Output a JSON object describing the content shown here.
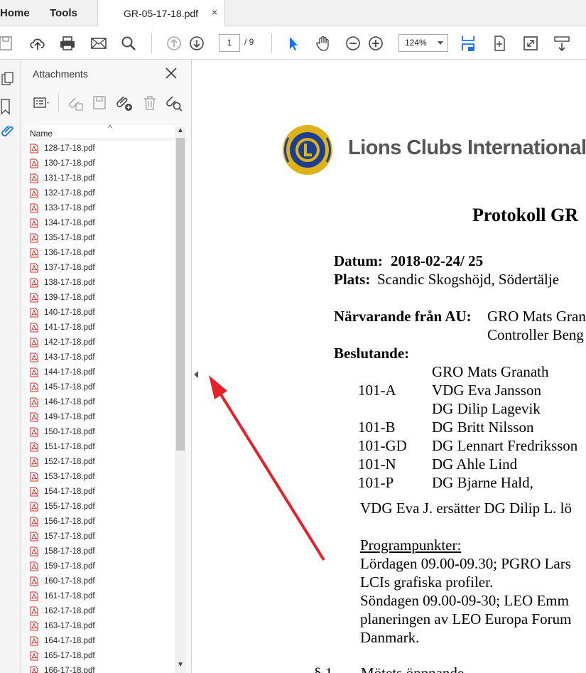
{
  "tabs": {
    "home": "Home",
    "tools": "Tools",
    "doc_tab": "GR-05-17-18.pdf",
    "close": "×"
  },
  "toolbar": {
    "page_current": "1",
    "page_total": "/ 9",
    "zoom": "124%"
  },
  "panel": {
    "title": "Attachments",
    "close": "✕",
    "column_name": "Name",
    "sort_icon": "^",
    "files": [
      "128-17-18.pdf",
      "130-17-18.pdf",
      "131-17-18.pdf",
      "132-17-18.pdf",
      "133-17-18.pdf",
      "134-17-18.pdf",
      "135-17-18.pdf",
      "136-17-18.pdf",
      "137-17-18.pdf",
      "138-17-18.pdf",
      "139-17-18.pdf",
      "140-17-18.pdf",
      "141-17-18.pdf",
      "142-17-18.pdf",
      "143-17-18.pdf",
      "144-17-18.pdf",
      "145-17-18.pdf",
      "146-17-18.pdf",
      "149-17-18.pdf",
      "150-17-18.pdf",
      "151-17-18.pdf",
      "152-17-18.pdf",
      "153-17-18.pdf",
      "154-17-18.pdf",
      "155-17-18.pdf",
      "156-17-18.pdf",
      "157-17-18.pdf",
      "158-17-18.pdf",
      "159-17-18.pdf",
      "160-17-18.pdf",
      "161-17-18.pdf",
      "162-17-18.pdf",
      "163-17-18.pdf",
      "164-17-18.pdf",
      "165-17-18.pdf",
      "166-17-18.pdf"
    ]
  },
  "document": {
    "brand": "Lions Clubs International",
    "heading": "Protokoll GR",
    "datum_label": "Datum:",
    "datum_value": "2018-02-24/ 25",
    "plats_label": "Plats:",
    "plats_value": "Scandic Skogshöjd, Södertälje",
    "narvarande_label": "Närvarande från AU:",
    "narvarande_value": "GRO Mats Gran",
    "narvarande_value2": "Controller Beng",
    "beslutande_label": "Beslutande:",
    "members": [
      {
        "district": "",
        "name": "GRO Mats Granath"
      },
      {
        "district": "101-A",
        "name": "VDG Eva Jansson"
      },
      {
        "district": "",
        "name": "DG Dilip Lagevik"
      },
      {
        "district": "101-B",
        "name": "DG Britt Nilsson"
      },
      {
        "district": "101-GD",
        "name": "DG Lennart Fredriksson"
      },
      {
        "district": "101-N",
        "name": "DG Ahle Lind"
      },
      {
        "district": "101-P",
        "name": "DG Bjarne Hald,"
      }
    ],
    "vdg_note": "VDG Eva J. ersätter DG Dilip L. lö",
    "program_heading": "Programpunkter:",
    "program_lines": [
      "Lördagen 09.00-09.30; PGRO Lars",
      "LCIs grafiska profiler.",
      "Söndagen 09.00-09-30; LEO Emm",
      "planeringen av LEO Europa Forum",
      "Danmark."
    ],
    "section_num": "§ 1",
    "section_title": "Mötets öppnande"
  },
  "colors": {
    "accent_blue": "#1473e6",
    "arrow_red": "#e8202a",
    "pdf_red": "#d9251d"
  }
}
